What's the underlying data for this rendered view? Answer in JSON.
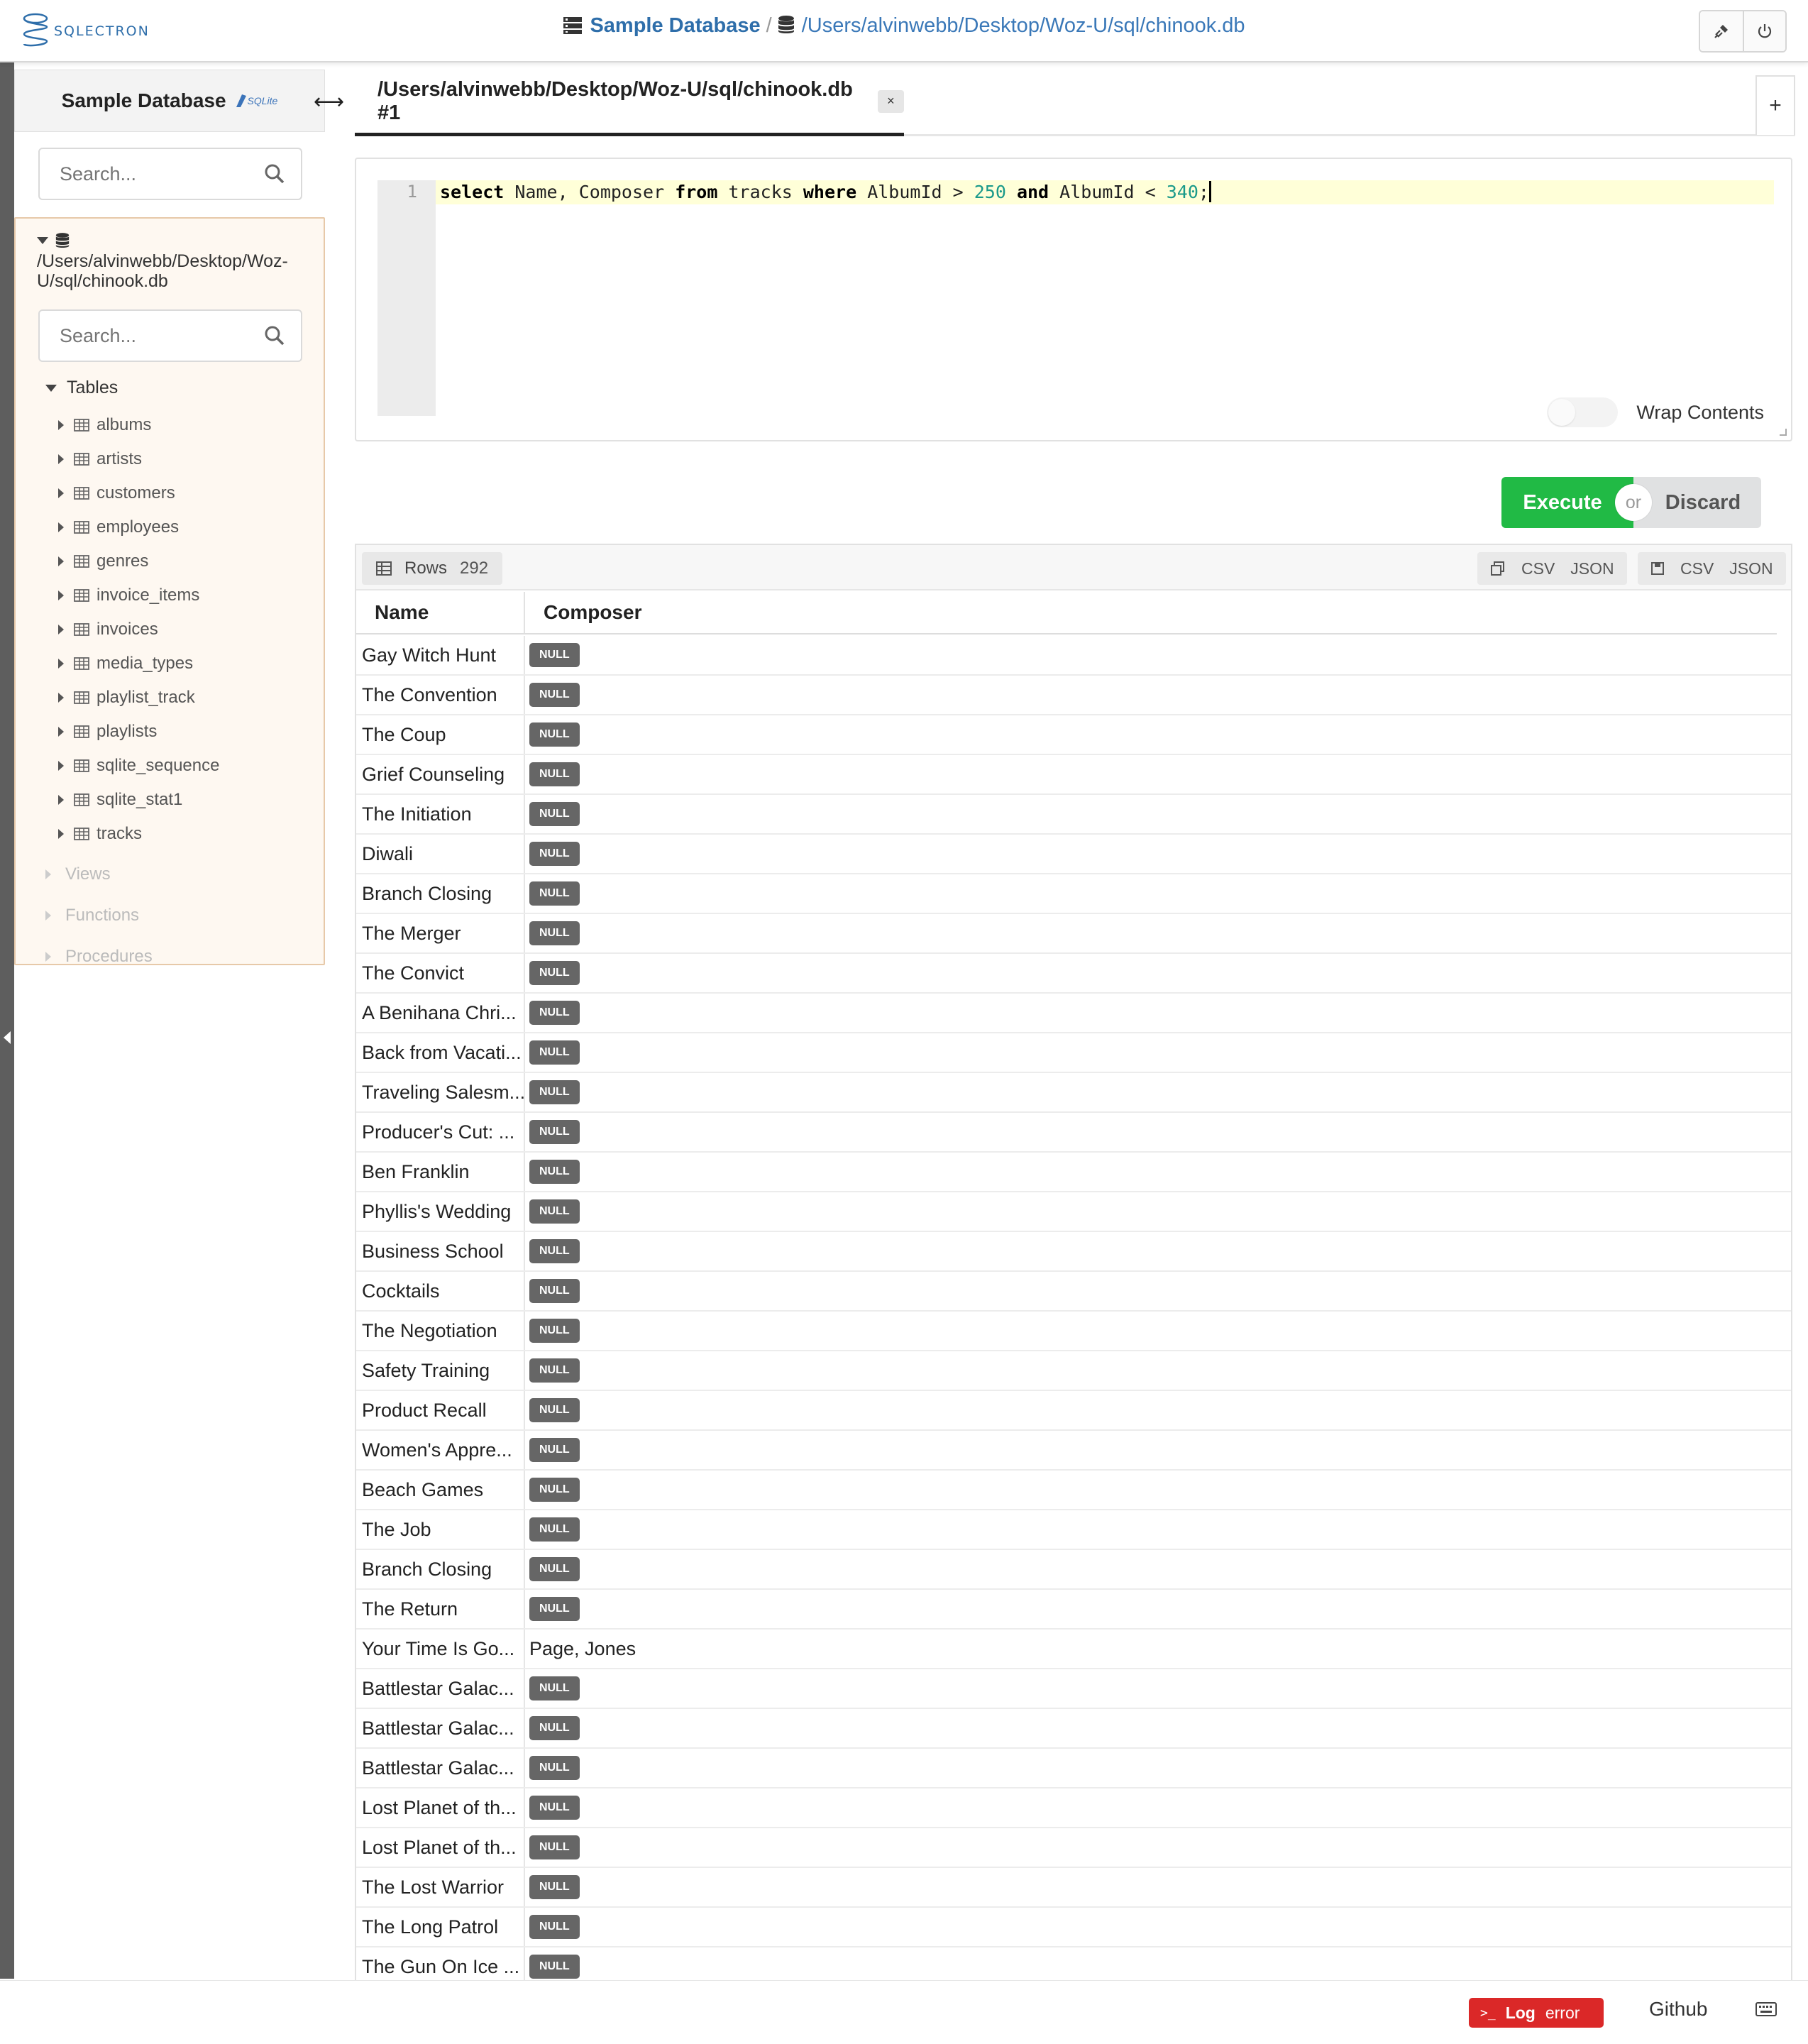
{
  "app": {
    "logo_text": "SQLECTRON"
  },
  "header": {
    "db_name": "Sample Database",
    "separator": "/",
    "db_path": "/Users/alvinwebb/Desktop/Woz-U/sql/chinook.db"
  },
  "sidebar": {
    "title": "Sample Database",
    "sqlite_badge": "SQLite",
    "search_placeholder": "Search...",
    "connection_path": "/Users/alvinwebb/Desktop/Woz-U/sql/chinook.db",
    "filter_placeholder": "Search...",
    "tables_label": "Tables",
    "tables": [
      "albums",
      "artists",
      "customers",
      "employees",
      "genres",
      "invoice_items",
      "invoices",
      "media_types",
      "playlist_track",
      "playlists",
      "sqlite_sequence",
      "sqlite_stat1",
      "tracks"
    ],
    "groups": [
      "Views",
      "Functions",
      "Procedures"
    ]
  },
  "tab": {
    "label": "/Users/alvinwebb/Desktop/Woz-U/sql/chinook.db #1",
    "close": "×",
    "add": "+"
  },
  "editor": {
    "line_number": "1",
    "query": "select Name, Composer from tracks where AlbumId > 250 and AlbumId < 340;",
    "wrap_label": "Wrap Contents"
  },
  "actions": {
    "execute": "Execute",
    "or": "or",
    "discard": "Discard"
  },
  "results": {
    "rows_label": "Rows",
    "rows_count": "292",
    "copy_csv": "CSV",
    "copy_json": "JSON",
    "save_csv": "CSV",
    "save_json": "JSON",
    "columns": [
      "Name",
      "Composer"
    ],
    "null_label": "NULL",
    "rows": [
      [
        "Gay Witch Hunt",
        null
      ],
      [
        "The Convention",
        null
      ],
      [
        "The Coup",
        null
      ],
      [
        "Grief Counseling",
        null
      ],
      [
        "The Initiation",
        null
      ],
      [
        "Diwali",
        null
      ],
      [
        "Branch Closing",
        null
      ],
      [
        "The Merger",
        null
      ],
      [
        "The Convict",
        null
      ],
      [
        "A Benihana Chri...",
        null
      ],
      [
        "Back from Vacati...",
        null
      ],
      [
        "Traveling Salesm...",
        null
      ],
      [
        "Producer's Cut: ...",
        null
      ],
      [
        "Ben Franklin",
        null
      ],
      [
        "Phyllis's Wedding",
        null
      ],
      [
        "Business School",
        null
      ],
      [
        "Cocktails",
        null
      ],
      [
        "The Negotiation",
        null
      ],
      [
        "Safety Training",
        null
      ],
      [
        "Product Recall",
        null
      ],
      [
        "Women's Appre...",
        null
      ],
      [
        "Beach Games",
        null
      ],
      [
        "The Job",
        null
      ],
      [
        "Branch Closing",
        null
      ],
      [
        "The Return",
        null
      ],
      [
        "Your Time Is Go...",
        "Page, Jones"
      ],
      [
        "Battlestar Galac...",
        null
      ],
      [
        "Battlestar Galac...",
        null
      ],
      [
        "Battlestar Galac...",
        null
      ],
      [
        "Lost Planet of th...",
        null
      ],
      [
        "Lost Planet of th...",
        null
      ],
      [
        "The Lost Warrior",
        null
      ],
      [
        "The Long Patrol",
        null
      ],
      [
        "The Gun On Ice ...",
        null
      ]
    ]
  },
  "footer": {
    "log_label": "Log",
    "log_status": "error",
    "github": "Github"
  },
  "colors": {
    "execute": "#21ba45",
    "discard": "#e0e1e2",
    "log_error": "#db2828",
    "link": "#3a78b8",
    "connection_bg": "#fef8f1"
  }
}
